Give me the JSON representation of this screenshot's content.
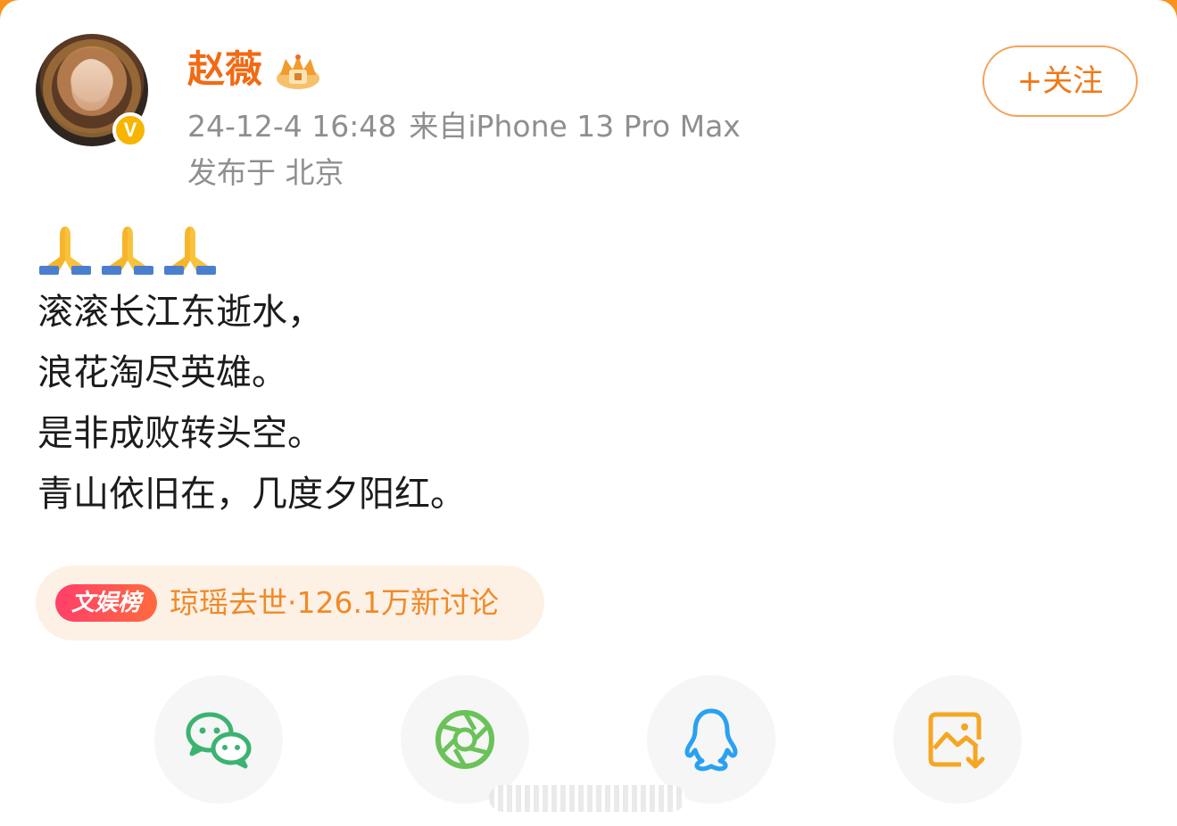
{
  "post": {
    "author": {
      "name": "赵薇",
      "verified_mark": "V",
      "badge_icon": "crown-badge-icon"
    },
    "follow_button_label": "+关注",
    "timestamp": "24-12-4 16:48",
    "source": "来自iPhone 13 Pro Max",
    "location": "发布于 北京",
    "emoji_icons": [
      "folded-hands-icon",
      "folded-hands-icon",
      "folded-hands-icon"
    ],
    "lines": [
      "滚滚长江东逝水，",
      "浪花淘尽英雄。",
      "是非成败转头空。",
      "青山依旧在，几度夕阳红。"
    ]
  },
  "topic": {
    "tag": "文娱榜",
    "text": "琼瑶去世·126.1万新讨论"
  },
  "share_bar": {
    "items": [
      {
        "icon": "wechat-icon",
        "color": "#3cb371"
      },
      {
        "icon": "moments-icon",
        "color": "#6ac259"
      },
      {
        "icon": "qq-icon",
        "color": "#29a1f2"
      },
      {
        "icon": "save-image-icon",
        "color": "#f5a623"
      }
    ]
  },
  "colors": {
    "accent": "#f16a14",
    "meta_gray": "#8f8f8f",
    "page_border": "#f7931e"
  }
}
